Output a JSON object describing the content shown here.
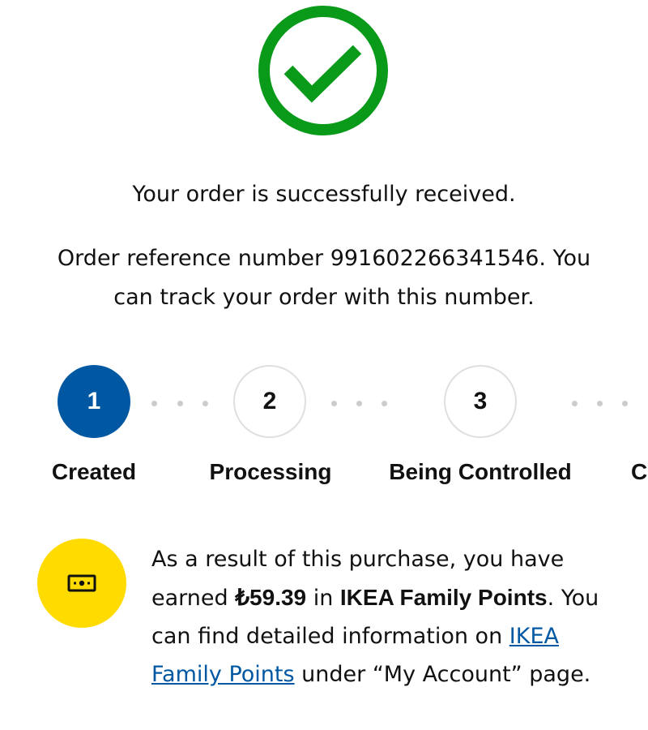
{
  "success_icon": "check-circle-icon",
  "colors": {
    "success": "#0a9a1a",
    "step_active": "#0058a3",
    "points_badge": "#ffdb00",
    "link": "#0058a3"
  },
  "messages": {
    "success": "Your order is successfully received.",
    "reference_line1": "Order reference number 991602266341546. You",
    "reference_line2": "can track your order with this number."
  },
  "steps": [
    {
      "number": "1",
      "label": "Created",
      "state": "active"
    },
    {
      "number": "2",
      "label": "Processing",
      "state": "inactive"
    },
    {
      "number": "3",
      "label": "Being Controlled",
      "state": "inactive"
    },
    {
      "number": "",
      "label": "C",
      "state": "inactive"
    }
  ],
  "points": {
    "icon": "cash-icon",
    "text_1": "As a result of this purchase, you have earned ",
    "amount": "₺59.39",
    "text_2": " in ",
    "program": "IKEA Family Points",
    "text_3": ". You can find detailed information on ",
    "link": "IKEA Family Points",
    "text_4": " under “My Account” page."
  }
}
